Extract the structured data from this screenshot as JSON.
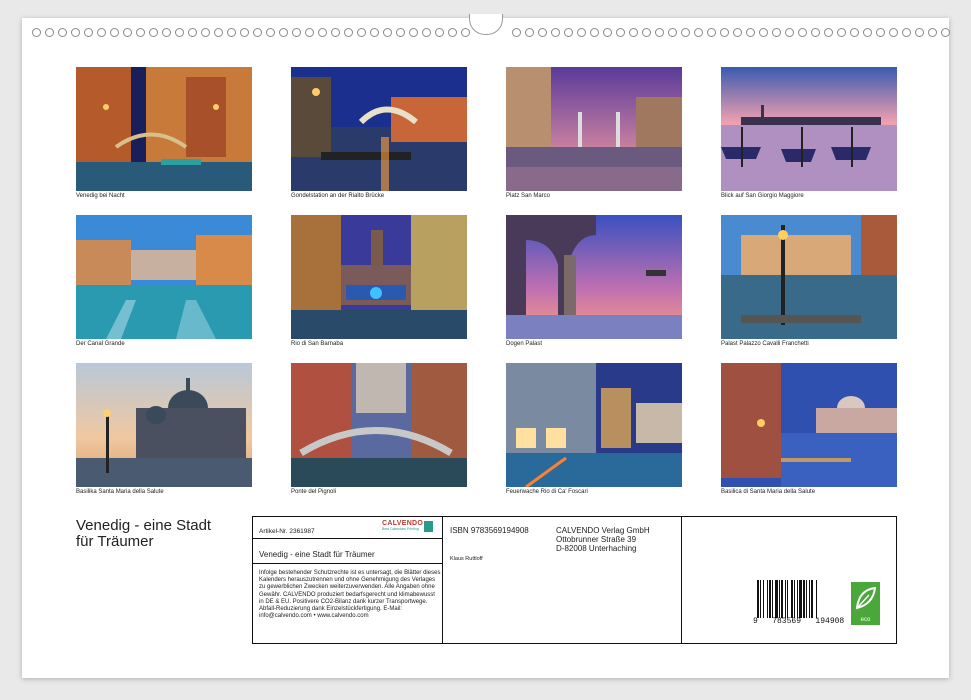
{
  "calendar_title": "Venedig - eine Stadt für Träumer",
  "title_lines": [
    "Venedig - eine Stadt",
    "für Träumer"
  ],
  "photos": [
    {
      "caption": "Venedig bei Nacht"
    },
    {
      "caption": "Gondelstation an der Rialto Brücke"
    },
    {
      "caption": "Platz San Marco"
    },
    {
      "caption": "Blick auf San Giorgio Maggiore"
    },
    {
      "caption": "Der Canal Grande"
    },
    {
      "caption": "Rio di San Barnaba"
    },
    {
      "caption": "Dogen Palast"
    },
    {
      "caption": "Palast Palazzo Cavalli Franchetti"
    },
    {
      "caption": "Basilika Santa Maria della Salute"
    },
    {
      "caption": "Ponte del Pignoli"
    },
    {
      "caption": "Feuerwache Rio di Ca' Foscari"
    },
    {
      "caption": "Basilica di Santa Maria della Salute"
    }
  ],
  "info": {
    "article": "Artikel-Nr. 2361987",
    "brand": "CALVENDO",
    "brand_sub": "Best Calendars Printing",
    "product_title": "Venedig - eine Stadt für Träumer",
    "legal_text": "Infolge bestehender Schutzrechte ist es untersagt, die Blätter dieses Kalenders herauszutrennen und ohne Genehmigung des Verlages zu gewerblichen Zwecken weiterzuverwenden. Alle Angaben ohne Gewähr. CALVENDO produziert bedarfsgerecht und klimabewusst in DE & EU. Positivere CO2-Bilanz dank kurzer Transportwege. Abfall-Reduzierung dank Einzelstückfertigung. E-Mail: info@calvendo.com • www.calvendo.com",
    "isbn": "ISBN 9783569194908",
    "publisher_name": "CALVENDO Verlag GmbH",
    "publisher_street": "Ottobrunner Straße 39",
    "publisher_city": "D-82008 Unterhaching",
    "author": "Klaus Ruttloff",
    "barcode_digits": "9   783569   194908",
    "eco_label": "eco"
  }
}
